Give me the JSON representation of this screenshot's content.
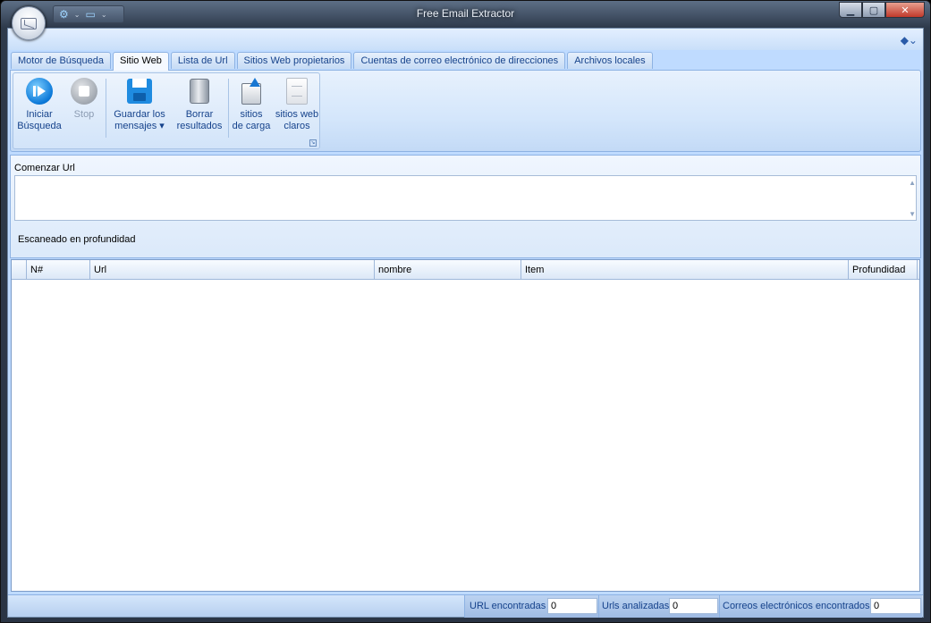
{
  "window": {
    "title": "Free Email Extractor"
  },
  "titlebar": {
    "orb_icon": "email-icon",
    "qat": [
      {
        "icon": "settings-icon"
      },
      {
        "icon": "monitor-icon"
      }
    ],
    "controls": {
      "minimize": "▁",
      "maximize": "▢",
      "close": "✕"
    }
  },
  "tabs": [
    {
      "label": "Motor de Búsqueda"
    },
    {
      "label": "Sitio Web"
    },
    {
      "label": "Lista de Url"
    },
    {
      "label": "Sitios Web propietarios"
    },
    {
      "label": "Cuentas de correo electrónico de direcciones"
    },
    {
      "label": "Archivos locales"
    }
  ],
  "ribbon": {
    "buttons": {
      "start": {
        "line1": "Iniciar",
        "line2": "Búsqueda"
      },
      "stop": {
        "line1": "Stop",
        "line2": ""
      },
      "save": {
        "line1": "Guardar los",
        "line2": "mensajes ▾"
      },
      "clear": {
        "line1": "Borrar",
        "line2": "resultados"
      },
      "load": {
        "line1": "sitios",
        "line2": "de carga"
      },
      "clear_sites": {
        "line1": "sitios web",
        "line2": "claros"
      }
    }
  },
  "url_section": {
    "label": "Comenzar Url",
    "value": "",
    "depth_label": "Escaneado en profundidad"
  },
  "grid": {
    "columns": [
      "",
      "N#",
      "Url",
      "nombre",
      "Item",
      "Profundidad"
    ],
    "rows": []
  },
  "status": {
    "urls_found_label": "URL encontradas",
    "urls_found": "0",
    "urls_analyzed_label": "Urls analizadas",
    "urls_analyzed": "0",
    "emails_found_label": "Correos electrónicos encontrados",
    "emails_found": "0"
  }
}
